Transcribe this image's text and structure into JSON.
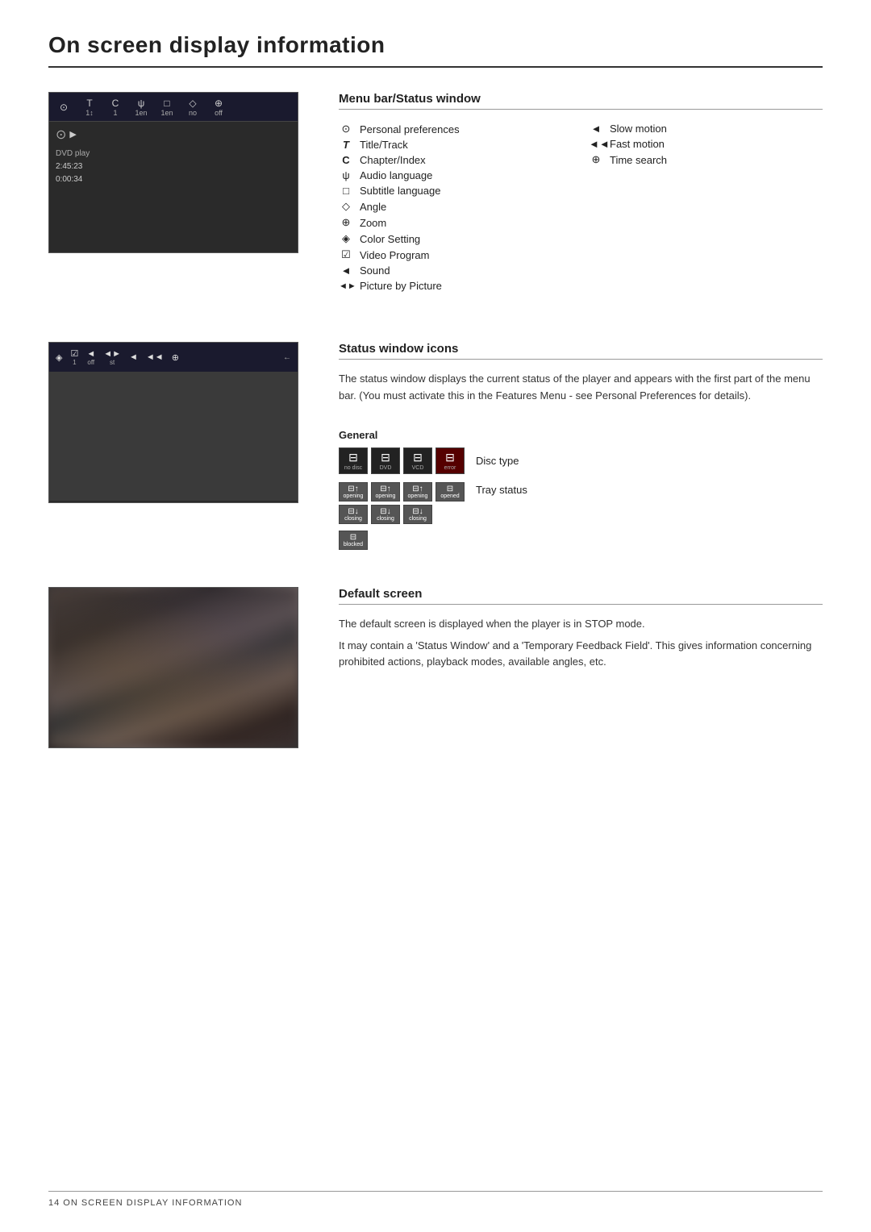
{
  "page": {
    "title": "On screen display information",
    "footer_text": "14 ON SCREEN DISPLAY INFORMATION"
  },
  "section1": {
    "header": "Menu bar/Status window",
    "left_items": [
      {
        "icon": "⊙",
        "label": "Personal preferences"
      },
      {
        "icon": "T",
        "label": "Title/Track"
      },
      {
        "icon": "C",
        "label": "Chapter/Index"
      },
      {
        "icon": "ψ",
        "label": "Audio language"
      },
      {
        "icon": "□",
        "label": "Subtitle language"
      },
      {
        "icon": "◇",
        "label": "Angle"
      },
      {
        "icon": "⊕",
        "label": "Zoom"
      },
      {
        "icon": "◈",
        "label": "Color Setting"
      },
      {
        "icon": "☑",
        "label": "Video Program"
      },
      {
        "icon": "◄",
        "label": "Sound"
      },
      {
        "icon": "◄►",
        "label": "Picture by Picture"
      }
    ],
    "right_items": [
      {
        "icon": "◄",
        "label": "Slow motion"
      },
      {
        "icon": "◄◄",
        "label": "Fast motion"
      },
      {
        "icon": "⊕",
        "label": "Time search"
      }
    ]
  },
  "dvd_screen": {
    "menu_items": [
      {
        "icon": "⊙",
        "val": ""
      },
      {
        "icon": "T",
        "val": "1"
      },
      {
        "icon": "C",
        "val": "1"
      },
      {
        "icon": "ψ",
        "val": "1en"
      },
      {
        "icon": "□",
        "val": "1en"
      },
      {
        "icon": "◇",
        "val": "no"
      },
      {
        "icon": "⊕",
        "val": "off"
      }
    ],
    "side_info": [
      "DVD  play",
      "2:45:23",
      "0:00:34"
    ]
  },
  "status_screen": {
    "items": [
      {
        "icon": "◈",
        "val": ""
      },
      {
        "icon": "☑",
        "val": "1"
      },
      {
        "icon": "◄",
        "val": "off"
      },
      {
        "icon": "◄►",
        "val": "st"
      },
      {
        "icon": "◄",
        "val": ""
      },
      {
        "icon": "◄◄",
        "val": ""
      },
      {
        "icon": "⊕",
        "val": ""
      }
    ]
  },
  "section2": {
    "header": "Status window icons",
    "description": "The status window displays the current status of the player and appears with the first part of the menu bar. (You must activate this in the Features Menu - see Personal Preferences for details).",
    "general_label": "General",
    "disc_icons": [
      {
        "top": "no disc",
        "bottom": ""
      },
      {
        "top": "DVD",
        "bottom": ""
      },
      {
        "top": "VCD",
        "bottom": ""
      },
      {
        "top": "error",
        "bottom": ""
      }
    ],
    "disc_type_label": "Disc type",
    "tray_row1": [
      {
        "label": "opening"
      },
      {
        "label": "opening"
      },
      {
        "label": "opening"
      },
      {
        "label": "opened"
      }
    ],
    "tray_row2": [
      {
        "label": "closing"
      },
      {
        "label": "closing"
      },
      {
        "label": "closing"
      }
    ],
    "blocked_label": "blocked",
    "tray_status_label": "Tray status"
  },
  "section3": {
    "header": "Default screen",
    "description1": "The default screen is displayed when the player is in STOP mode.",
    "description2": "It may contain a 'Status Window' and a 'Temporary Feedback Field'. This gives information concerning prohibited actions, playback modes, available angles, etc."
  }
}
